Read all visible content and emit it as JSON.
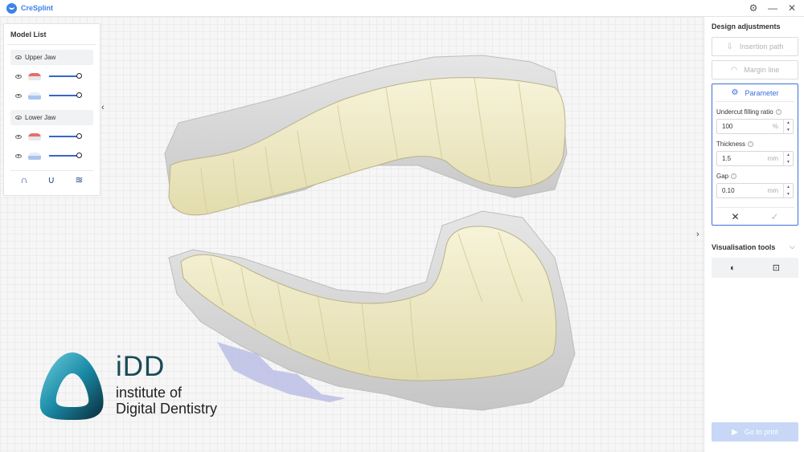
{
  "app": {
    "title": "CreSplint"
  },
  "window_controls": {
    "settings": "⚙",
    "minimize": "—",
    "close": "✕"
  },
  "model_list": {
    "title": "Model List",
    "upper_jaw": {
      "label": "Upper Jaw"
    },
    "lower_jaw": {
      "label": "Lower Jaw"
    },
    "view_icons": [
      "∩",
      "∪",
      "≊"
    ],
    "collapse": "‹"
  },
  "right_panel": {
    "title": "Design adjustments",
    "insertion_path": "Insertion path",
    "margin_line": "Margin line",
    "parameter": {
      "title": "Parameter",
      "undercut": {
        "label": "Undercut filling ratio",
        "value": "100",
        "unit": "%"
      },
      "thickness": {
        "label": "Thickness",
        "value": "1.5",
        "unit": "mm"
      },
      "gap": {
        "label": "Gap",
        "value": "0.10",
        "unit": "mm"
      },
      "cancel": "✕",
      "confirm": "✓"
    },
    "visualisation": {
      "title": "Visualisation tools",
      "chevron": "⌵"
    },
    "go_to_print": "Go to print",
    "expand": "›"
  },
  "logo": {
    "big": "iDD",
    "line1": "institute of",
    "line2": "Digital Dentistry"
  },
  "colors": {
    "accent": "#3c6fdc",
    "splint": "#f0ecc9",
    "scan": "#d4d4d4"
  }
}
